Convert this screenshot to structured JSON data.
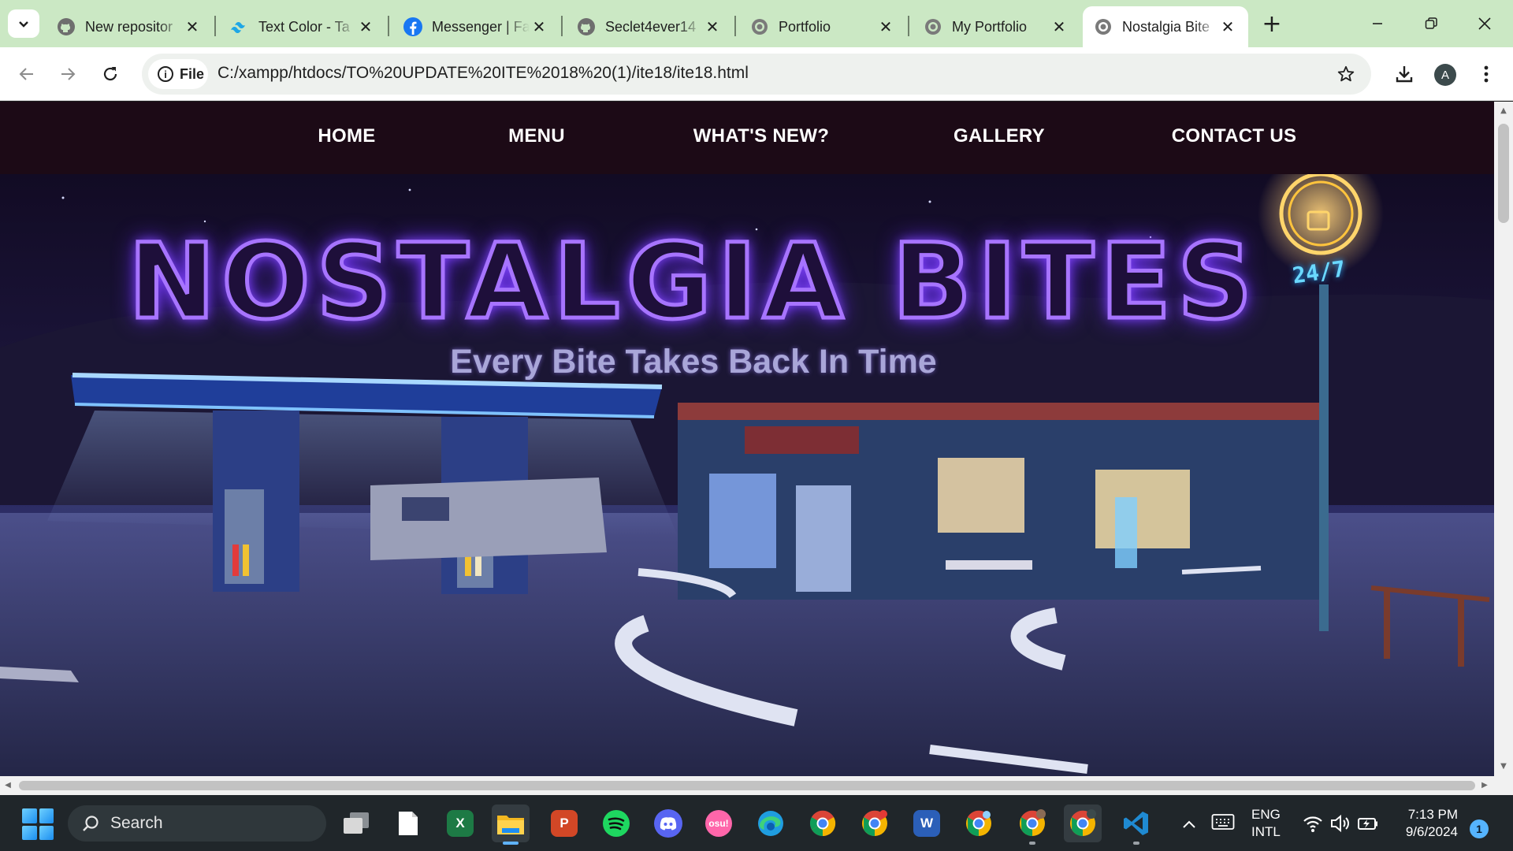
{
  "browser": {
    "tabs": [
      {
        "title": "New repositor",
        "favicon": "github-icon",
        "active": false
      },
      {
        "title": "Text Color - Ta",
        "favicon": "tailwind-icon",
        "active": false
      },
      {
        "title": "Messenger | Fa",
        "favicon": "facebook-icon",
        "active": false
      },
      {
        "title": "Seclet4ever14",
        "favicon": "github-icon",
        "active": false
      },
      {
        "title": "Portfolio",
        "favicon": "globe-icon",
        "active": false
      },
      {
        "title": "My Portfolio",
        "favicon": "globe-icon",
        "active": false
      },
      {
        "title": "Nostalgia Bite",
        "favicon": "globe-icon",
        "active": true
      }
    ],
    "address_bar": {
      "scheme_chip": "File",
      "url": "C:/xampp/htdocs/TO%20UPDATE%20ITE%2018%20(1)/ite18/ite18.html"
    },
    "profile_initial": "A",
    "accent_color": "#cbe8c4"
  },
  "site": {
    "nav": [
      "HOME",
      "MENU",
      "WHAT'S NEW?",
      "GALLERY",
      "CONTACT US"
    ],
    "logo": "NOSTALGIA BITES",
    "tagline": "Every Bite Takes Back In Time",
    "neon_sign": "24/7",
    "colors": {
      "nav_bg": "#1c0a16",
      "logo_neon": "#a774ff",
      "tagline": "#a9a6d8"
    }
  },
  "taskbar": {
    "search_placeholder": "Search",
    "apps": [
      "task-view-icon",
      "file-icon",
      "excel-icon",
      "file-explorer-icon",
      "powerpoint-icon",
      "spotify-icon",
      "discord-icon",
      "osu-icon",
      "edge-icon",
      "chrome-icon",
      "chrome-icon",
      "word-icon",
      "chrome-icon",
      "chrome-icon",
      "chrome-icon",
      "vscode-icon"
    ],
    "osu_label": "osu!",
    "word_label": "W",
    "excel_label": "X",
    "ppt_label": "P",
    "language": {
      "line1": "ENG",
      "line2": "INTL"
    },
    "clock": {
      "time": "7:13 PM",
      "date": "9/6/2024"
    },
    "notification_count": "1"
  }
}
